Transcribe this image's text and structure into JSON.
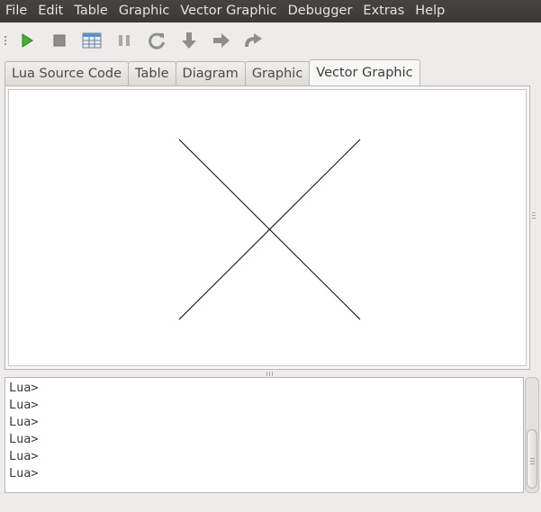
{
  "menubar": {
    "items": [
      "File",
      "Edit",
      "Table",
      "Graphic",
      "Vector Graphic",
      "Debugger",
      "Extras",
      "Help"
    ]
  },
  "toolbar": {
    "buttons": [
      {
        "icon": "run-icon",
        "color": "#3da52b"
      },
      {
        "icon": "stop-icon",
        "color": "#8c8c8a"
      },
      {
        "icon": "table-icon",
        "color": "#4f7fb8"
      },
      {
        "icon": "pause-icon",
        "color": "#9a9a98"
      },
      {
        "icon": "restart-icon",
        "color": "#8c8c8a"
      },
      {
        "icon": "step-into-icon",
        "color": "#8c8c8a"
      },
      {
        "icon": "step-over-icon",
        "color": "#8c8c8a"
      },
      {
        "icon": "step-out-icon",
        "color": "#8c8c8a"
      }
    ]
  },
  "tabs": [
    {
      "label": "Lua Source Code",
      "active": false
    },
    {
      "label": "Table",
      "active": false
    },
    {
      "label": "Diagram",
      "active": false
    },
    {
      "label": "Graphic",
      "active": false
    },
    {
      "label": "Vector Graphic",
      "active": true
    }
  ],
  "canvas": {
    "shape": "x-cross",
    "stroke_color": "#000000"
  },
  "console": {
    "lines": [
      "Lua>",
      "Lua>",
      "Lua>",
      "Lua>",
      "Lua>",
      "Lua>"
    ]
  },
  "colors": {
    "menubar_bg": "#3c3b37",
    "menubar_text": "#e6e4df",
    "window_bg": "#edecea"
  }
}
